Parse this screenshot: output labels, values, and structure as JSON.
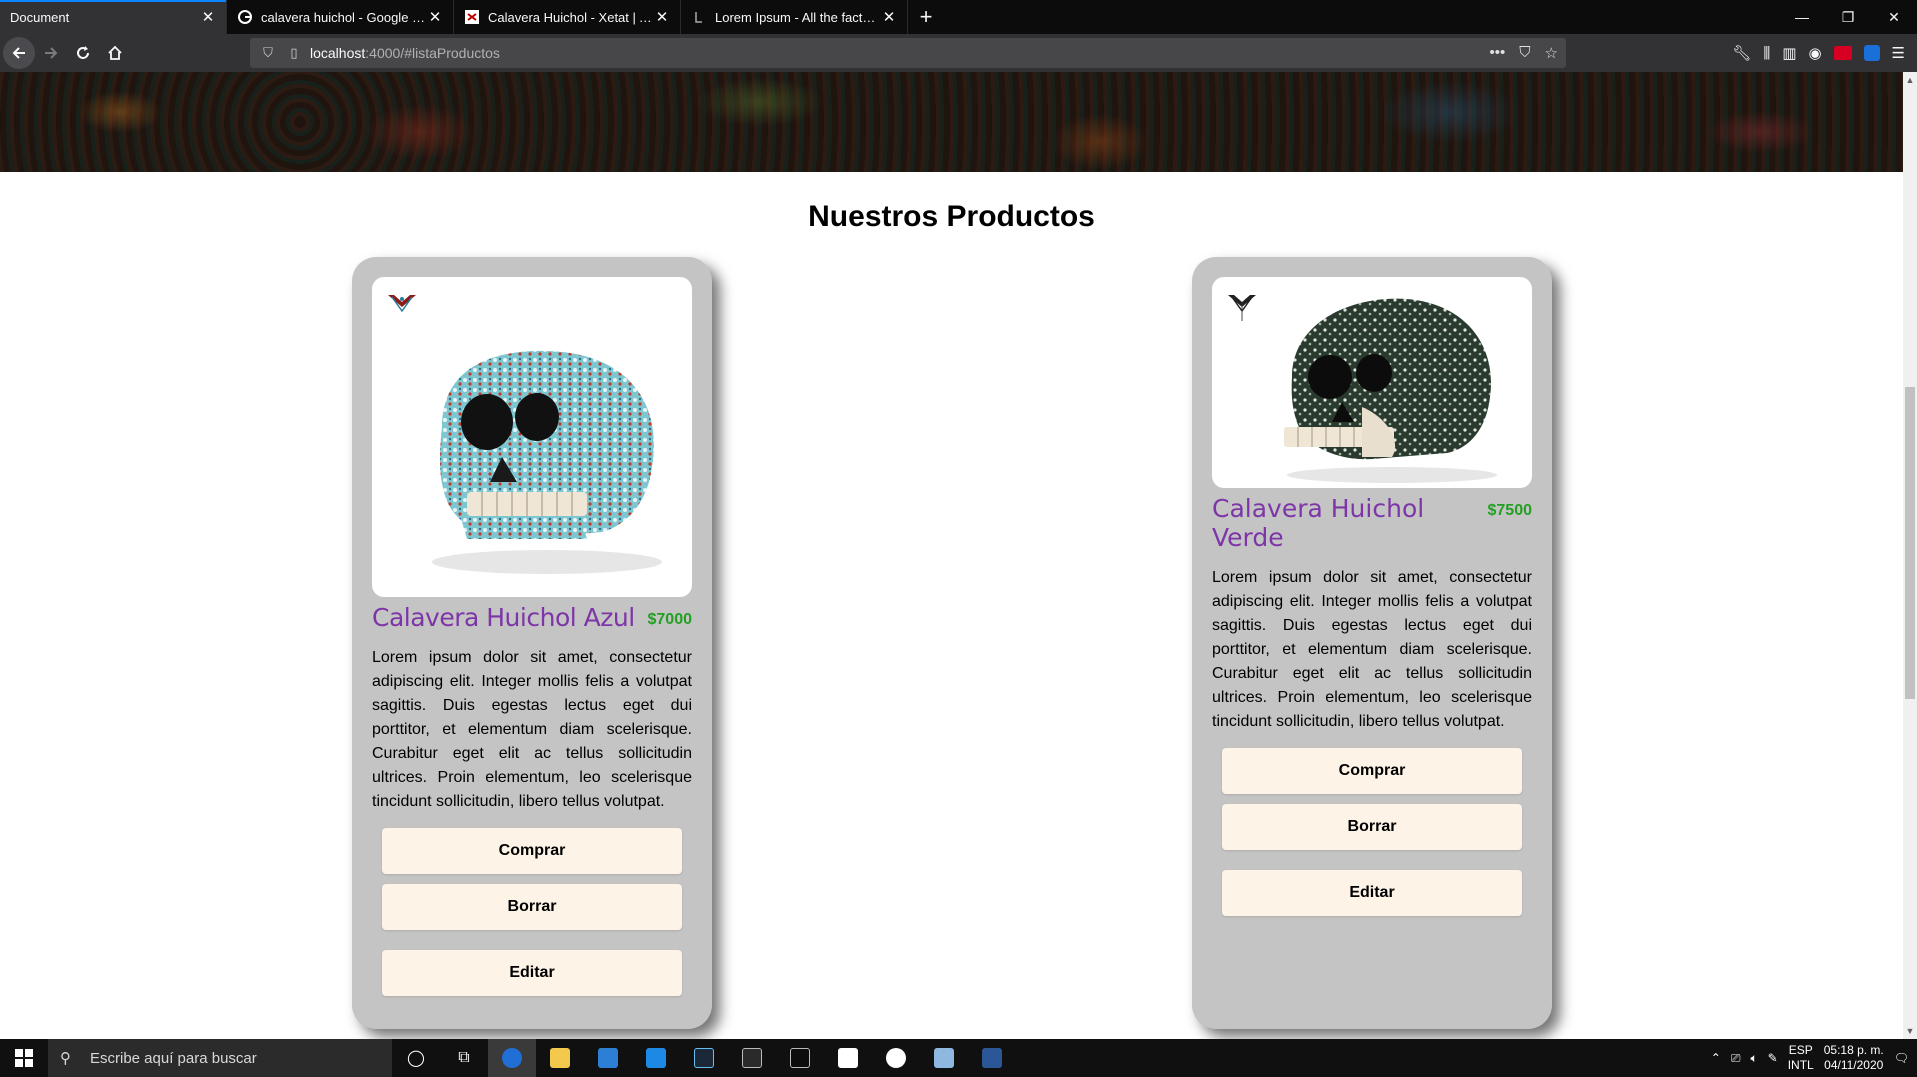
{
  "browser": {
    "tabs": [
      {
        "title": "Document",
        "favicon": "none",
        "active": true
      },
      {
        "title": "calavera huichol - Google Shopping",
        "favicon": "google-icon",
        "active": false
      },
      {
        "title": "Calavera Huichol - Xetat | Arte Huichol",
        "favicon": "xetat-icon",
        "active": false
      },
      {
        "title": "Lorem Ipsum - All the facts - Lipsum generator",
        "favicon": "lipsum-icon",
        "active": false
      }
    ],
    "url_host": "localhost",
    "url_path": ":4000/#listaProductos"
  },
  "page": {
    "section_title": "Nuestros Productos",
    "products": [
      {
        "name": "Calavera Huichol Azul",
        "price": "$7000",
        "description": "Lorem ipsum dolor sit amet, consectetur adipiscing elit. Integer mollis felis a volutpat sagittis. Duis egestas lectus eget dui porttitor, et elementum diam scelerisque. Curabitur eget elit ac tellus sollicitudin ultrices. Proin elementum, leo scelerisque tincidunt sollicitudin, libero tellus volutpat.",
        "buy_label": "Comprar",
        "delete_label": "Borrar",
        "edit_label": "Editar"
      },
      {
        "name": "Calavera Huichol Verde",
        "price": "$7500",
        "description": "Lorem ipsum dolor sit amet, consectetur adipiscing elit. Integer mollis felis a volutpat sagittis. Duis egestas lectus eget dui porttitor, et elementum diam scelerisque. Curabitur eget elit ac tellus sollicitudin ultrices. Proin elementum, leo scelerisque tincidunt sollicitudin, libero tellus volutpat.",
        "buy_label": "Comprar",
        "delete_label": "Borrar",
        "edit_label": "Editar"
      }
    ]
  },
  "taskbar": {
    "search_placeholder": "Escribe aquí para buscar",
    "lang_top": "ESP",
    "lang_bottom": "INTL",
    "time": "05:18 p. m.",
    "date": "04/11/2020"
  },
  "colors": {
    "product_name": "#7d35a8",
    "price": "#23a023",
    "card_bg": "#c4c4c4",
    "button_bg": "#fdf3e6"
  }
}
